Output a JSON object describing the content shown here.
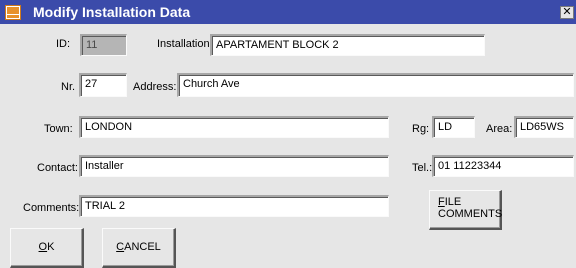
{
  "window": {
    "title": "Modify Installation Data",
    "close_glyph": "✕",
    "app_icon": "lamp-logo-icon"
  },
  "fields": {
    "id": {
      "label": "ID:",
      "value": "11"
    },
    "installation": {
      "label": "Installation:",
      "value": "APARTAMENT BLOCK 2"
    },
    "nr": {
      "label": "Nr.",
      "value": "27"
    },
    "address": {
      "label": "Address:",
      "value": "Church Ave"
    },
    "town": {
      "label": "Town:",
      "value": "LONDON"
    },
    "rg": {
      "label": "Rg:",
      "value": "LD"
    },
    "area": {
      "label": "Area:",
      "value": "LD65WS"
    },
    "contact": {
      "label": "Contact:",
      "value": "Installer"
    },
    "tel": {
      "label": "Tel.:",
      "value": "01 11223344"
    },
    "comments": {
      "label": "Comments:",
      "value": "TRIAL 2"
    }
  },
  "buttons": {
    "ok": {
      "mnemonic": "O",
      "rest": "K"
    },
    "cancel": {
      "mnemonic": "C",
      "rest": "ANCEL"
    },
    "file_comments": {
      "mnemonic": "F",
      "line1_rest": "ILE",
      "line2": "COMMENTS"
    }
  },
  "colors": {
    "title_bar": "#3b4baa",
    "dialog_bg": "#e6e6e6",
    "disabled_field": "#b5b5b5"
  }
}
